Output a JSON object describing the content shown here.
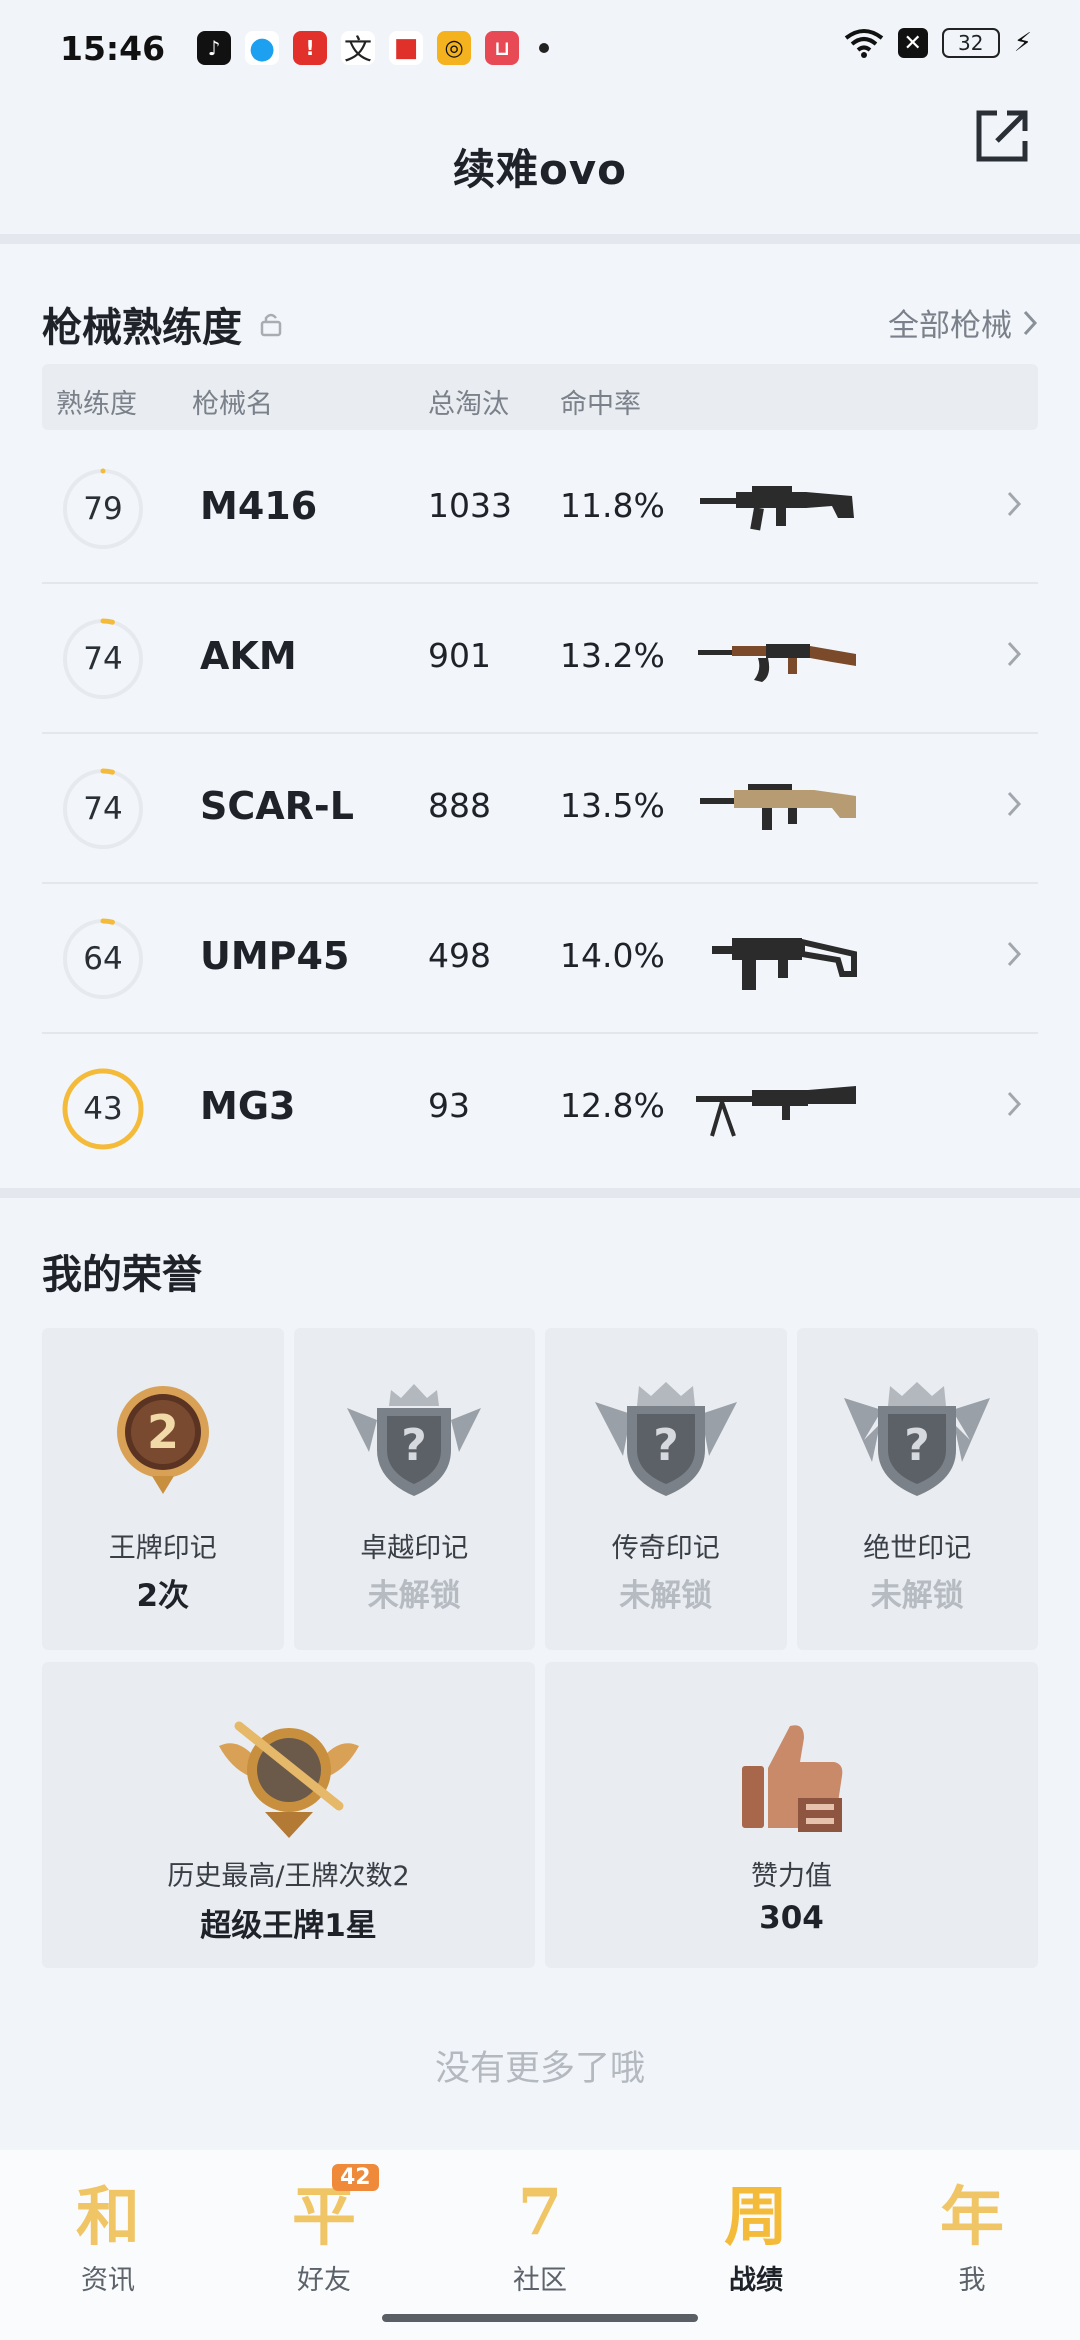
{
  "status_bar": {
    "time": "15:46",
    "notifications": [
      {
        "icon": "tiktok-icon",
        "glyph": "♪",
        "cls": "tiktok"
      },
      {
        "icon": "qq-icon",
        "glyph": "●",
        "cls": "qq"
      },
      {
        "icon": "red-app-icon",
        "glyph": "!",
        "cls": "red1"
      },
      {
        "icon": "zhi-app-icon",
        "glyph": "文",
        "cls": "zhi"
      },
      {
        "icon": "red-box-icon",
        "glyph": "■",
        "cls": "redbox"
      },
      {
        "icon": "yellow-app-icon",
        "glyph": "◎",
        "cls": "yellow"
      },
      {
        "icon": "red-bag-icon",
        "glyph": "⊔",
        "cls": "red2"
      }
    ],
    "battery": "32"
  },
  "header": {
    "title": "续难ovo"
  },
  "weapons": {
    "title": "枪械熟练度",
    "all_link": "全部枪械",
    "columns": {
      "proficiency": "熟练度",
      "name": "枪械名",
      "kills": "总淘汰",
      "accuracy": "命中率"
    },
    "rows": [
      {
        "level": "79",
        "progress": 0.0,
        "name": "M416",
        "kills": "1033",
        "accuracy": "11.8%",
        "gun": "m416"
      },
      {
        "level": "74",
        "progress": 0.04,
        "name": "AKM",
        "kills": "901",
        "accuracy": "13.2%",
        "gun": "akm"
      },
      {
        "level": "74",
        "progress": 0.04,
        "name": "SCAR-L",
        "kills": "888",
        "accuracy": "13.5%",
        "gun": "scar"
      },
      {
        "level": "64",
        "progress": 0.04,
        "name": "UMP45",
        "kills": "498",
        "accuracy": "14.0%",
        "gun": "ump"
      },
      {
        "level": "43",
        "progress": 1.0,
        "name": "MG3",
        "kills": "93",
        "accuracy": "12.8%",
        "gun": "mg3"
      }
    ]
  },
  "honors": {
    "title": "我的荣誉",
    "badges": [
      {
        "label": "王牌印记",
        "value": "2次",
        "locked": false
      },
      {
        "label": "卓越印记",
        "value": "未解锁",
        "locked": true
      },
      {
        "label": "传奇印记",
        "value": "未解锁",
        "locked": true
      },
      {
        "label": "绝世印记",
        "value": "未解锁",
        "locked": true
      }
    ],
    "big": [
      {
        "label": "历史最高/王牌次数2",
        "value": "超级王牌1星"
      },
      {
        "label": "赞力值",
        "value": "304"
      }
    ]
  },
  "footer": {
    "no_more": "没有更多了哦"
  },
  "nav": {
    "items": [
      {
        "glyph": "和",
        "label": "资讯",
        "active": false
      },
      {
        "glyph": "平",
        "label": "好友",
        "active": false,
        "badge": "42"
      },
      {
        "glyph": "7",
        "label": "社区",
        "active": false
      },
      {
        "glyph": "周",
        "label": "战绩",
        "active": true
      },
      {
        "glyph": "年",
        "label": "我",
        "active": false
      }
    ]
  },
  "colors": {
    "accent": "#f4bb3a",
    "ring_track": "#e6e9ee",
    "badge_gold": "#c8903e",
    "badge_silver": "#8f959c"
  }
}
